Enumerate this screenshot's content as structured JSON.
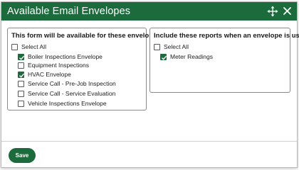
{
  "dialog": {
    "title": "Available Email Envelopes",
    "icons": {
      "move": "move-arrows-icon",
      "close": "close-icon"
    }
  },
  "left_panel": {
    "header": "This form will be available for these envelopes:",
    "select_all": {
      "label": "Select All",
      "checked": false
    },
    "options": [
      {
        "label": "Boiler Inspections Envelope",
        "checked": true
      },
      {
        "label": "Equipment Inspections",
        "checked": false
      },
      {
        "label": "HVAC Envelope",
        "checked": true
      },
      {
        "label": "Service Call - Pre-Job Inspection",
        "checked": false
      },
      {
        "label": "Service Call - Service Evaluation",
        "checked": false
      },
      {
        "label": "Vehicle Inspections Envelope",
        "checked": false
      }
    ]
  },
  "right_panel": {
    "header": "Include these reports when an envelope is used:",
    "select_all": {
      "label": "Select All",
      "checked": false
    },
    "options": [
      {
        "label": "Meter Readings",
        "checked": true
      }
    ]
  },
  "footer": {
    "save_label": "Save"
  },
  "colors": {
    "brand": "#1c6b3c"
  }
}
